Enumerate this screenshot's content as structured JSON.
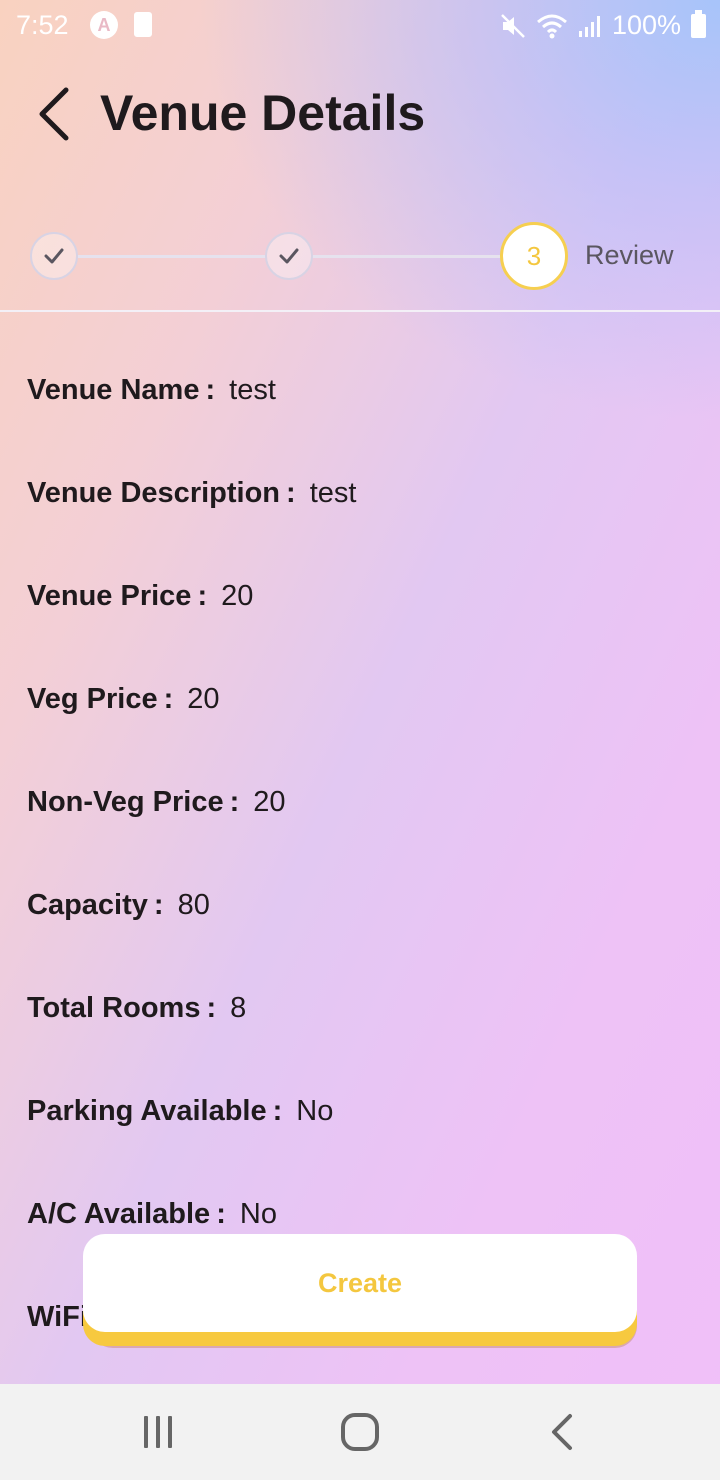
{
  "status_bar": {
    "time": "7:52",
    "battery_percent": "100%"
  },
  "header": {
    "title": "Venue Details"
  },
  "stepper": {
    "active_step_number": "3",
    "active_step_label": "Review",
    "accent_color": "#f4c73f"
  },
  "details": [
    {
      "label": "Venue Name",
      "value": "test"
    },
    {
      "label": "Venue Description",
      "value": "test"
    },
    {
      "label": "Venue Price",
      "value": "20"
    },
    {
      "label": "Veg Price",
      "value": "20"
    },
    {
      "label": "Non-Veg Price",
      "value": "20"
    },
    {
      "label": "Capacity",
      "value": "80"
    },
    {
      "label": "Total Rooms",
      "value": "8"
    },
    {
      "label": "Parking Available",
      "value": "No"
    },
    {
      "label": "A/C Available",
      "value": "No"
    },
    {
      "label": "WiFi",
      "value": ""
    }
  ],
  "details_separator": ":",
  "create_button": {
    "label": "Create"
  }
}
